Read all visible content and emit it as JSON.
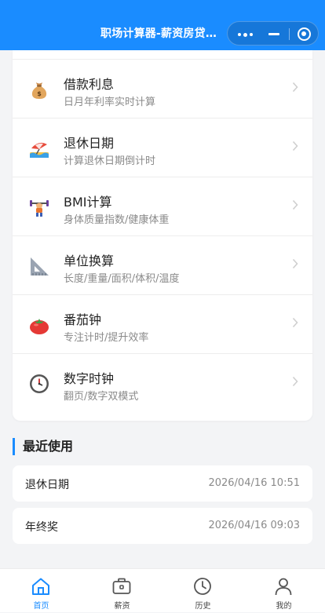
{
  "header": {
    "title": "职场计算器-薪资房贷..."
  },
  "colors": {
    "accent": "#1a8cff",
    "card_bg": "#ffffff",
    "page_bg": "#f3f4f6",
    "muted_text": "#8a8a8a"
  },
  "tools": [
    {
      "name": "借款利息",
      "desc": "日月年利率实时计算",
      "icon": "money-bag-icon"
    },
    {
      "name": "退休日期",
      "desc": "计算退休日期倒计时",
      "icon": "beach-umbrella-icon"
    },
    {
      "name": "BMI计算",
      "desc": "身体质量指数/健康体重",
      "icon": "weightlifter-icon"
    },
    {
      "name": "单位换算",
      "desc": "长度/重量/面积/体积/温度",
      "icon": "triangle-ruler-icon"
    },
    {
      "name": "番茄钟",
      "desc": "专注计时/提升效率",
      "icon": "tomato-icon"
    },
    {
      "name": "数字时钟",
      "desc": "翻页/数字双模式",
      "icon": "clock-icon"
    }
  ],
  "recent": {
    "title": "最近使用",
    "items": [
      {
        "name": "退休日期",
        "time": "2026/04/16 10:51"
      },
      {
        "name": "年终奖",
        "time": "2026/04/16 09:03"
      }
    ]
  },
  "tabbar": {
    "items": [
      {
        "label": "首页",
        "icon": "home-icon",
        "active": true
      },
      {
        "label": "薪资",
        "icon": "briefcase-icon",
        "active": false
      },
      {
        "label": "历史",
        "icon": "clock-icon",
        "active": false
      },
      {
        "label": "我的",
        "icon": "user-icon",
        "active": false
      }
    ]
  }
}
